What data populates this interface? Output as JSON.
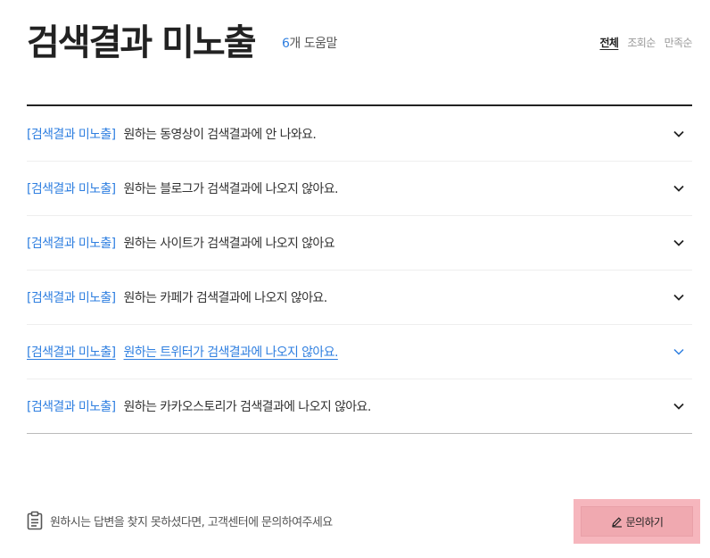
{
  "header": {
    "title": "검색결과 미노출",
    "count_num": "6",
    "count_label": "개 도움말",
    "sort": [
      "전체",
      "조회순",
      "만족순"
    ]
  },
  "faq": [
    {
      "category": "[검색결과 미노출]",
      "question": "원하는 동영상이 검색결과에 안 나와요."
    },
    {
      "category": "[검색결과 미노출]",
      "question": "원하는 블로그가 검색결과에 나오지 않아요."
    },
    {
      "category": "[검색결과 미노출]",
      "question": "원하는 사이트가 검색결과에 나오지 않아요"
    },
    {
      "category": "[검색결과 미노출]",
      "question": "원하는 카페가 검색결과에 나오지 않아요."
    },
    {
      "category": "[검색결과 미노출]",
      "question": "원하는 트위터가 검색결과에 나오지 않아요."
    },
    {
      "category": "[검색결과 미노출]",
      "question": "원하는 카카오스토리가 검색결과에 나오지 않아요."
    }
  ],
  "footer": {
    "note": "원하시는 답변을 찾지 못하셨다면, 고객센터에 문의하여주세요",
    "inquiry_label": "문의하기",
    "icon": "clipboard-icon"
  },
  "colors": {
    "accent": "#2f7fe0",
    "button_bg": "#f0a9b0"
  }
}
